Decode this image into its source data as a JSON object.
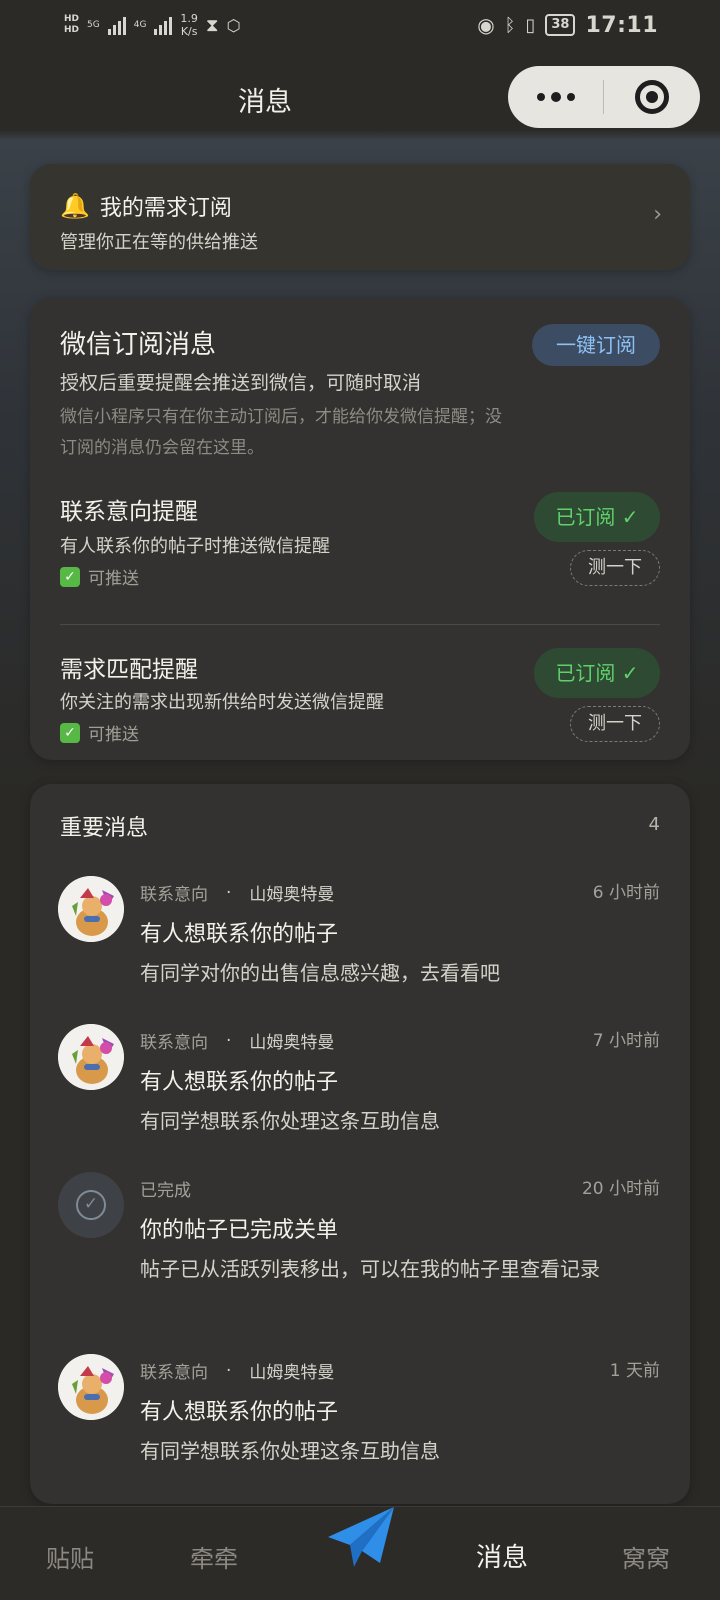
{
  "status_bar": {
    "hd1": "HD",
    "hd2": "HD",
    "net1": "5G",
    "net2": "4G",
    "speed_value": "1.9",
    "speed_unit": "K/s",
    "battery": "38",
    "time": "17:11"
  },
  "nav": {
    "title": "消息"
  },
  "subscription_card": {
    "title": "我的需求订阅",
    "description": "管理你正在等的供给推送"
  },
  "wechat_card": {
    "title": "微信订阅消息",
    "subscribe_all_label": "一键订阅",
    "description": "授权后重要提醒会推送到微信，可随时取消",
    "note": "微信小程序只有在你主动订阅后，才能给你发微信提醒；没订阅的消息仍会留在这里。",
    "rows": [
      {
        "title": "联系意向提醒",
        "description": "有人联系你的帖子时推送微信提醒",
        "status": "可推送",
        "subscribed_label": "已订阅 ✓",
        "test_label": "测一下"
      },
      {
        "title": "需求匹配提醒",
        "description": "你关注的需求出现新供给时发送微信提醒",
        "status": "可推送",
        "subscribed_label": "已订阅 ✓",
        "test_label": "测一下"
      }
    ]
  },
  "messages": {
    "header": "重要消息",
    "count": "4",
    "items": [
      {
        "category": "联系意向",
        "dot": "·",
        "author": "山姆奥特曼",
        "time": "6 小时前",
        "title": "有人想联系你的帖子",
        "body": "有同学对你的出售信息感兴趣，去看看吧",
        "avatar": "cartoon-avatar"
      },
      {
        "category": "联系意向",
        "dot": "·",
        "author": "山姆奥特曼",
        "time": "7 小时前",
        "title": "有人想联系你的帖子",
        "body": "有同学想联系你处理这条互助信息",
        "avatar": "cartoon-avatar"
      },
      {
        "category": "已完成",
        "time": "20 小时前",
        "title": "你的帖子已完成关单",
        "body": "帖子已从活跃列表移出，可以在我的帖子里查看记录",
        "avatar": "check-circle-icon"
      },
      {
        "category": "联系意向",
        "dot": "·",
        "author": "山姆奥特曼",
        "time": "1 天前",
        "title": "有人想联系你的帖子",
        "body": "有同学想联系你处理这条互助信息",
        "avatar": "cartoon-avatar"
      }
    ]
  },
  "tab_bar": {
    "tabs": [
      {
        "label": "贴贴"
      },
      {
        "label": "牵牵"
      },
      {
        "label": "消息"
      },
      {
        "label": "窝窝"
      }
    ],
    "active_tab": "消息",
    "center_icon": "paper-plane-icon",
    "accent_color": "#2f8fe8"
  },
  "colors": {
    "subscribed_green": "#5fd16b",
    "subscribe_blue": "#8ec0f2",
    "bell_yellow": "#f5c543"
  }
}
